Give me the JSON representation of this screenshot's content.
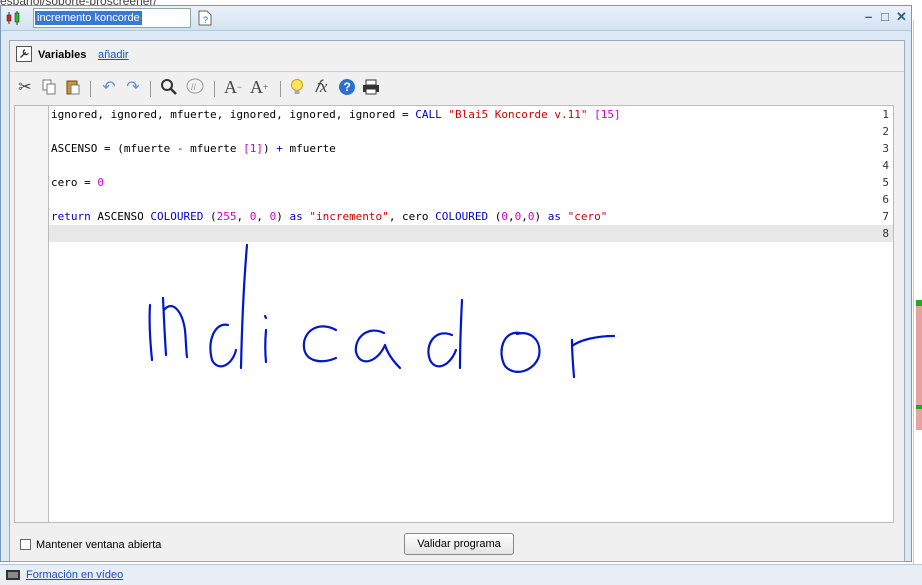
{
  "background": {
    "url_fragment": "espanol/soporte-proscreener/"
  },
  "window": {
    "title_value": "incremento koncorde",
    "controls": [
      "–",
      "□",
      "✕"
    ]
  },
  "variables": {
    "label": "Variables",
    "add_link": "añadir"
  },
  "toolbar": {
    "icons": [
      "scissors-icon",
      "copy-icon",
      "paste-icon",
      "undo-icon",
      "redo-icon",
      "search-icon",
      "comment-icon",
      "font-decrease-icon",
      "font-increase-icon",
      "lightbulb-icon",
      "function-icon",
      "help-icon",
      "print-icon"
    ]
  },
  "editor": {
    "line_numbers": [
      "1",
      "2",
      "3",
      "4",
      "5",
      "6",
      "7",
      "8"
    ],
    "lines": [
      [
        {
          "t": "ignored, ignored, mfuerte, ignored, ignored, ignored = ",
          "c": "p"
        },
        {
          "t": "CALL ",
          "c": "k"
        },
        {
          "t": "\"Blai5 Koncorde v.11\"",
          "c": "s"
        },
        {
          "t": " ",
          "c": "p"
        },
        {
          "t": "[15]",
          "c": "n"
        }
      ],
      [],
      [
        {
          "t": "ASCENSO = (mfuerte ",
          "c": "p"
        },
        {
          "t": "-",
          "c": "op"
        },
        {
          "t": " mfuerte ",
          "c": "p"
        },
        {
          "t": "[1]",
          "c": "n"
        },
        {
          "t": ") ",
          "c": "p"
        },
        {
          "t": "+",
          "c": "op"
        },
        {
          "t": " mfuerte",
          "c": "p"
        }
      ],
      [],
      [
        {
          "t": "cero = ",
          "c": "p"
        },
        {
          "t": "0",
          "c": "n"
        }
      ],
      [],
      [
        {
          "t": "return ",
          "c": "k"
        },
        {
          "t": "ASCENSO ",
          "c": "p"
        },
        {
          "t": "COLOURED ",
          "c": "k"
        },
        {
          "t": "(",
          "c": "p"
        },
        {
          "t": "255",
          "c": "n"
        },
        {
          "t": ", ",
          "c": "p"
        },
        {
          "t": "0",
          "c": "n"
        },
        {
          "t": ", ",
          "c": "p"
        },
        {
          "t": "0",
          "c": "n"
        },
        {
          "t": ") ",
          "c": "p"
        },
        {
          "t": "as ",
          "c": "k"
        },
        {
          "t": "\"incremento\"",
          "c": "s"
        },
        {
          "t": ", cero ",
          "c": "p"
        },
        {
          "t": "COLOURED ",
          "c": "k"
        },
        {
          "t": "(",
          "c": "p"
        },
        {
          "t": "0",
          "c": "n"
        },
        {
          "t": ",",
          "c": "p"
        },
        {
          "t": "0",
          "c": "n"
        },
        {
          "t": ",",
          "c": "p"
        },
        {
          "t": "0",
          "c": "n"
        },
        {
          "t": ") ",
          "c": "p"
        },
        {
          "t": "as ",
          "c": "k"
        },
        {
          "t": "\"cero\"",
          "c": "s"
        }
      ],
      []
    ],
    "annotation_text": "Indicador"
  },
  "footer": {
    "keep_open_label": "Mantener ventana abierta",
    "keep_open_checked": false,
    "validate_button": "Validar programa"
  },
  "statusbar": {
    "link": "Formación en vídeo"
  },
  "colors": {
    "keyword": "#0000cc",
    "string": "#cc0000",
    "number": "#cc00cc",
    "handwriting": "#0018c8"
  }
}
